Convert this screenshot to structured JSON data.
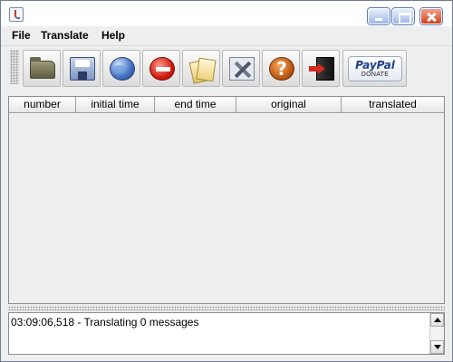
{
  "window": {
    "title": "",
    "icon": "java-cup-icon"
  },
  "menu": {
    "items": [
      "File",
      "Translate",
      "Help"
    ]
  },
  "toolbar": {
    "buttons": [
      {
        "icon": "open-folder-icon"
      },
      {
        "icon": "save-icon"
      },
      {
        "icon": "globe-icon"
      },
      {
        "icon": "stop-icon"
      },
      {
        "icon": "cards-icon"
      },
      {
        "icon": "tools-icon"
      },
      {
        "icon": "help-icon",
        "glyph": "?"
      },
      {
        "icon": "exit-icon"
      }
    ],
    "paypal": {
      "logo": "PayPal",
      "label": "DONATE",
      "brand_color": "#1f3f8c"
    }
  },
  "table": {
    "columns": [
      "number",
      "initial time",
      "end time",
      "original",
      "translated"
    ],
    "rows": []
  },
  "log": {
    "lines": [
      "03:09:06,518 - Translating 0 messages"
    ]
  }
}
